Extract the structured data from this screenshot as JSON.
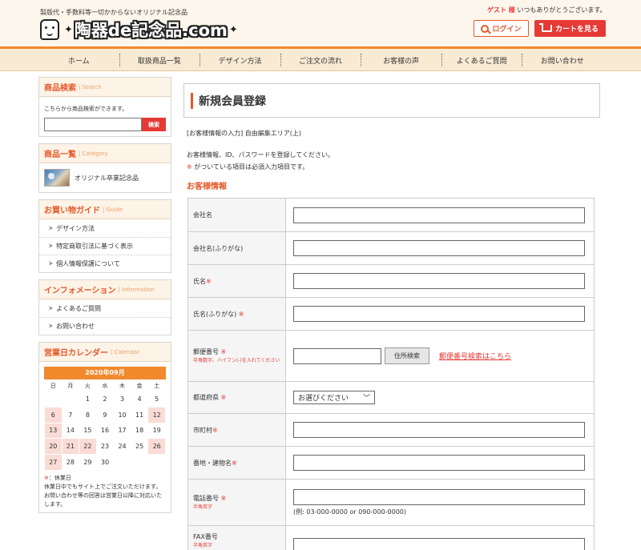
{
  "header": {
    "tagline": "製版代・手数料等一切かからないオリジナル記念品",
    "logo_text": "陶器de記念品.com",
    "guest_name": "ゲスト 様",
    "guest_greeting": "いつもありがとうございます。",
    "login_label": "ログイン",
    "cart_label": "カートを見る"
  },
  "nav": {
    "items": [
      "ホーム",
      "取扱商品一覧",
      "デザイン方法",
      "ご注文の流れ",
      "お客様の声",
      "よくあるご質問",
      "お問い合わせ"
    ]
  },
  "sidebar": {
    "search": {
      "title": "商品検索",
      "title_en": "Search",
      "desc": "こちらから商品検索ができます。",
      "button": "検索"
    },
    "category": {
      "title": "商品一覧",
      "title_en": "Category",
      "item": "オリジナル卒業記念品"
    },
    "guide": {
      "title": "お買い物ガイド",
      "title_en": "Guide",
      "items": [
        "デザイン方法",
        "特定商取引法に基づく表示",
        "個人情報保護について"
      ]
    },
    "info": {
      "title": "インフォメーション",
      "title_en": "Information",
      "items": [
        "よくあるご質問",
        "お問い合わせ"
      ]
    },
    "calendar": {
      "title": "営業日カレンダー",
      "title_en": "Calendar",
      "month": "2020年09月",
      "weekdays": [
        "日",
        "月",
        "火",
        "水",
        "木",
        "金",
        "土"
      ],
      "weeks": [
        [
          "",
          "",
          "1",
          "2",
          "3",
          "4",
          "5"
        ],
        [
          "6",
          "7",
          "8",
          "9",
          "10",
          "11",
          "12"
        ],
        [
          "13",
          "14",
          "15",
          "16",
          "17",
          "18",
          "19"
        ],
        [
          "20",
          "21",
          "22",
          "23",
          "24",
          "25",
          "26"
        ],
        [
          "27",
          "28",
          "29",
          "30",
          "",
          "",
          ""
        ]
      ],
      "holidays": [
        "6",
        "12",
        "13",
        "20",
        "21",
        "22",
        "26",
        "27"
      ],
      "note_mark": "※",
      "note_title": "：休業日",
      "note_body": "休業日中でもサイト上でご注文いただけます。お問い合わせ等の回答は営業日以降に対応いたします。"
    }
  },
  "main": {
    "title": "新規会員登録",
    "free_area": "[お客様情報の入力] 自由編集エリア(上)",
    "intro_line1": "お客様情報、ID、パスワードを登録してください。",
    "intro_mark": "※",
    "intro_line2": "がついている項目は必須入力項目です。",
    "section_title": "お客様情報",
    "fields": {
      "company": "会社名",
      "company_kana": "会社名(ふりがな)",
      "name": "氏名",
      "name_kana": "氏名(ふりがな)",
      "zip": "郵便番号",
      "zip_note": "半角数字、ハイフン(-)を入れてください",
      "zip_button": "住所検索",
      "zip_link": "郵便番号検索はこちら",
      "pref": "都道府県",
      "pref_value": "お選びください",
      "city": "市町村",
      "street": "番地・建物名",
      "tel": "電話番号",
      "tel_note": "半角英字",
      "tel_example": "(例: 03-000-0000 or 090-000-0000)",
      "fax": "FAX番号",
      "fax_note": "半角英字",
      "required_mark": "※"
    }
  },
  "colors": {
    "accent": "#e8572a",
    "red": "#e53935",
    "nav_bg": "#f8ead3",
    "holiday": "#fadbd6"
  }
}
